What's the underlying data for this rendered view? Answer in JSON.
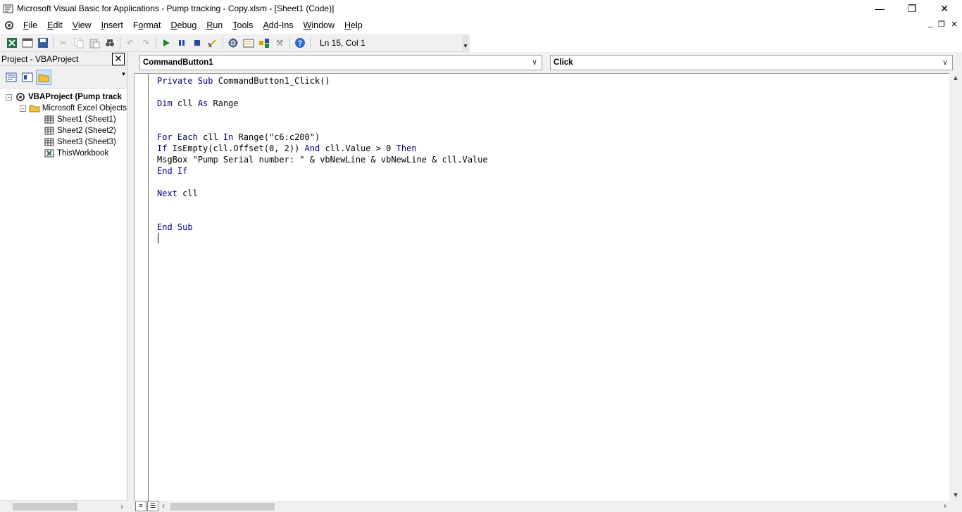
{
  "window": {
    "title": "Microsoft Visual Basic for Applications - Pump tracking - Copy.xlsm - [Sheet1 (Code)]",
    "minimize": "—",
    "restore": "❐",
    "close": "✕"
  },
  "menu": {
    "items": [
      {
        "label": "File",
        "accel": "F"
      },
      {
        "label": "Edit",
        "accel": "E"
      },
      {
        "label": "View",
        "accel": "V"
      },
      {
        "label": "Insert",
        "accel": "I"
      },
      {
        "label": "Format",
        "accel": "o"
      },
      {
        "label": "Debug",
        "accel": "D"
      },
      {
        "label": "Run",
        "accel": "R"
      },
      {
        "label": "Tools",
        "accel": "T"
      },
      {
        "label": "Add-Ins",
        "accel": "A"
      },
      {
        "label": "Window",
        "accel": "W"
      },
      {
        "label": "Help",
        "accel": "H"
      }
    ],
    "mdi_minimize": "_",
    "mdi_restore": "❐",
    "mdi_close": "✕"
  },
  "toolbar": {
    "position": "Ln 15, Col 1",
    "icons": [
      "excel-icon",
      "insert-userform-icon",
      "save-icon",
      "cut-icon",
      "copy-icon",
      "paste-icon",
      "find-icon",
      "undo-icon",
      "redo-icon",
      "run-icon",
      "break-icon",
      "reset-icon",
      "design-mode-icon",
      "project-explorer-icon",
      "properties-icon",
      "object-browser-icon",
      "toolbox-icon",
      "help-icon"
    ]
  },
  "project": {
    "header": "Project - VBAProject",
    "close": "✕",
    "tree": {
      "root": "VBAProject (Pump track",
      "folder": "Microsoft Excel Objects",
      "items": [
        "Sheet1 (Sheet1)",
        "Sheet2 (Sheet2)",
        "Sheet3 (Sheet3)",
        "ThisWorkbook"
      ]
    }
  },
  "code": {
    "object_combo": "CommandButton1",
    "procedure_combo": "Click",
    "lines": [
      [
        {
          "t": "Private Sub",
          "k": true
        },
        {
          "t": " CommandButton1_Click()"
        }
      ],
      [],
      [
        {
          "t": "Dim",
          "k": true
        },
        {
          "t": " cll "
        },
        {
          "t": "As",
          "k": true
        },
        {
          "t": " Range"
        }
      ],
      [],
      [],
      [
        {
          "t": "For Each",
          "k": true
        },
        {
          "t": " cll "
        },
        {
          "t": "In",
          "k": true
        },
        {
          "t": " Range(\"c6:c200\")"
        }
      ],
      [
        {
          "t": "If",
          "k": true
        },
        {
          "t": " IsEmpty(cll.Offset(0, 2)) "
        },
        {
          "t": "And",
          "k": true
        },
        {
          "t": " cll.Value > 0 "
        },
        {
          "t": "Then",
          "k": true
        }
      ],
      [
        {
          "t": "MsgBox \"Pump Serial number: \" & vbNewLine & vbNewLine & cll.Value"
        }
      ],
      [
        {
          "t": "End If",
          "k": true
        }
      ],
      [],
      [
        {
          "t": "Next",
          "k": true
        },
        {
          "t": " cll"
        }
      ],
      [],
      [],
      [
        {
          "t": "End Sub",
          "k": true
        }
      ]
    ]
  },
  "colors": {
    "keyword": "#00008b",
    "chrome": "#f0f0f0"
  }
}
